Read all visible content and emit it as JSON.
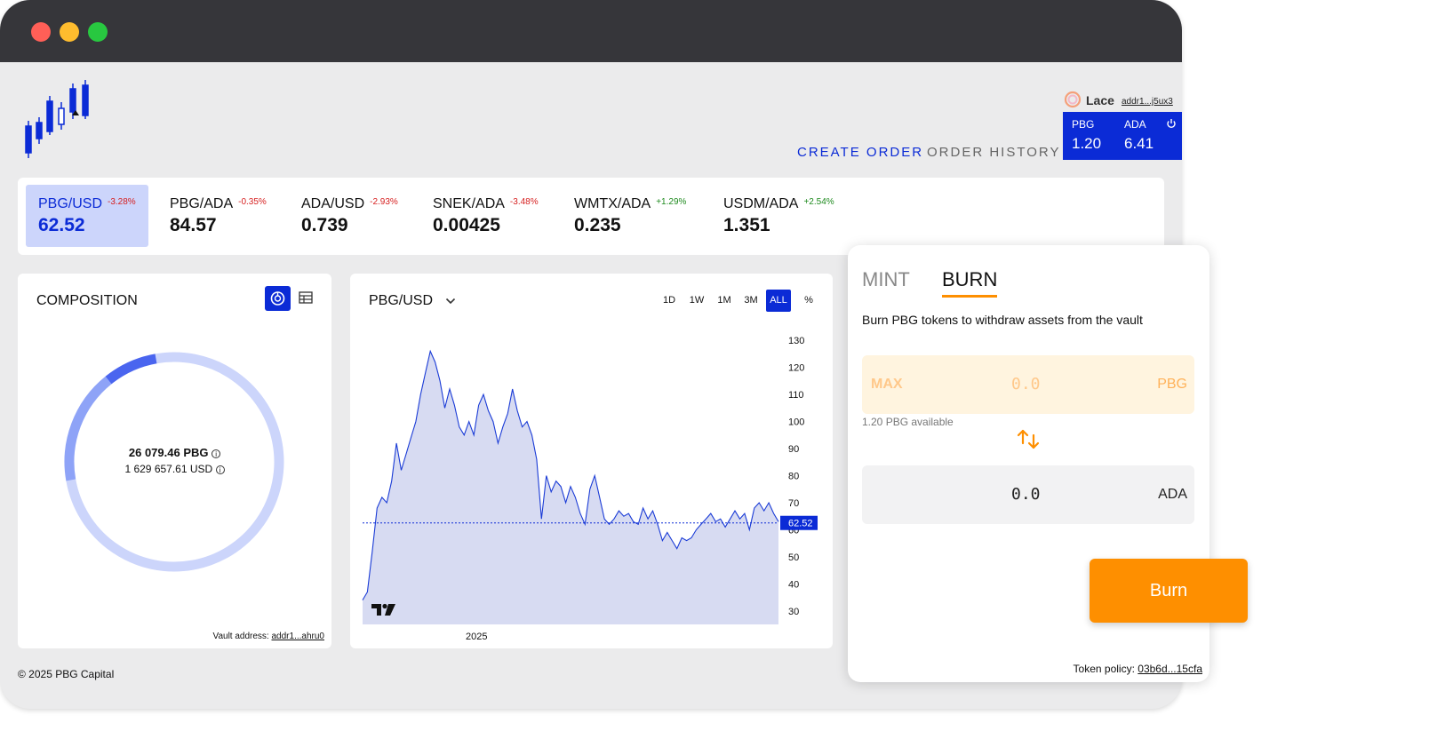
{
  "colors": {
    "accent": "#0b2bd6",
    "orange": "#fe8f00",
    "positive": "#1e8a1e",
    "negative": "#d62020"
  },
  "window": {
    "dots": [
      "#ff5f57",
      "#febc2e",
      "#28c840"
    ]
  },
  "header": {
    "nav": {
      "create_order": "CREATE ORDER",
      "order_history": "ORDER HISTORY"
    },
    "wallet": {
      "name": "Lace",
      "address": "addr1...j5ux3",
      "balances": [
        {
          "symbol": "PBG",
          "amount": "1.20"
        },
        {
          "symbol": "ADA",
          "amount": "6.41"
        }
      ],
      "power_icon": "power-icon"
    }
  },
  "tickers": [
    {
      "pair": "PBG/USD",
      "change": "-3.28%",
      "price": "62.52",
      "direction": "down",
      "active": true
    },
    {
      "pair": "PBG/ADA",
      "change": "-0.35%",
      "price": "84.57",
      "direction": "down"
    },
    {
      "pair": "ADA/USD",
      "change": "-2.93%",
      "price": "0.739",
      "direction": "down"
    },
    {
      "pair": "SNEK/ADA",
      "change": "-3.48%",
      "price": "0.00425",
      "direction": "down"
    },
    {
      "pair": "WMTX/ADA",
      "change": "+1.29%",
      "price": "0.235",
      "direction": "up"
    },
    {
      "pair": "USDM/ADA",
      "change": "+2.54%",
      "price": "1.351",
      "direction": "up"
    }
  ],
  "composition": {
    "title": "COMPOSITION",
    "view_icons": [
      "donut-chart-icon",
      "table-icon"
    ],
    "total_pbg": "26 079.46 PBG",
    "total_usd": "1 629 657.61 USD",
    "vault_label": "Vault address:",
    "vault_address": "addr1...ahru0",
    "segments": [
      {
        "fraction": 0.75,
        "color": "#ccd5fb"
      },
      {
        "fraction": 0.17,
        "color": "#8ea3f7"
      },
      {
        "fraction": 0.08,
        "color": "#4a65ef"
      }
    ]
  },
  "price_chart": {
    "pair": "PBG/USD",
    "timeframes": [
      "1D",
      "1W",
      "1M",
      "3M",
      "ALL",
      "%"
    ],
    "selected_timeframe": "ALL",
    "last_price": "62.52",
    "x_label": "2025",
    "watermark": "tradingview-logo"
  },
  "chart_data": {
    "type": "area",
    "y_ticks": [
      130,
      120,
      110,
      100,
      90,
      80,
      70,
      60,
      50,
      40,
      30
    ],
    "ylim": [
      25,
      135
    ],
    "x_ticks": [
      "2025"
    ],
    "series": [
      {
        "values": [
          34,
          37,
          52,
          68,
          72,
          70,
          78,
          92,
          82,
          88,
          94,
          100,
          110,
          118,
          126,
          122,
          115,
          105,
          112,
          106,
          98,
          95,
          100,
          95,
          106,
          110,
          104,
          100,
          92,
          98,
          103,
          112,
          104,
          98,
          100,
          95,
          86,
          64,
          80,
          74,
          78,
          76,
          70,
          76,
          72,
          66,
          62,
          75,
          80,
          72,
          64,
          62,
          64,
          67,
          65,
          66,
          63,
          62,
          68,
          64,
          67,
          62,
          56,
          59,
          56,
          53,
          57,
          56,
          57,
          60,
          62,
          64,
          66,
          63,
          64,
          61,
          64,
          67,
          64,
          66,
          60,
          68,
          70,
          67,
          70,
          66,
          63
        ]
      }
    ],
    "last_value": 62.52
  },
  "swap": {
    "tabs": [
      "MINT",
      "BURN"
    ],
    "active_tab": "BURN",
    "description": "Burn PBG tokens to withdraw assets from the vault",
    "from": {
      "max_label": "MAX",
      "value": "0.0",
      "symbol": "PBG",
      "available": "1.20 PBG available"
    },
    "to": {
      "value": "0.0",
      "symbol": "ADA"
    },
    "button": "Burn",
    "policy_label": "Token policy:",
    "policy_id": "03b6d...15cfa"
  },
  "footer": {
    "copyright": "© 2025 PBG Capital"
  }
}
